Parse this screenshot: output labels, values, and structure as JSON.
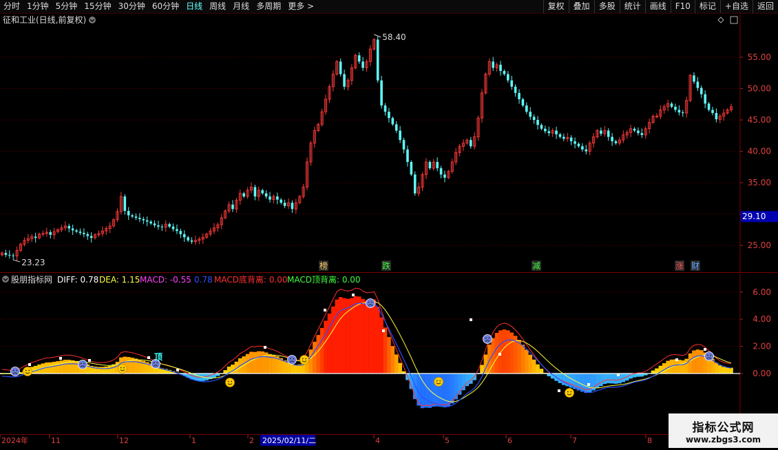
{
  "toolbar": {
    "periods": [
      "分时",
      "1分钟",
      "5分钟",
      "15分钟",
      "30分钟",
      "60分钟",
      "日线",
      "周线",
      "月线",
      "多周期",
      "更多 >"
    ],
    "active": "日线",
    "right": [
      "复权",
      "叠加",
      "多股",
      "统计",
      "画线",
      "F10",
      "标记",
      "+自选",
      "返回"
    ]
  },
  "main": {
    "title": "征和工业(日线,前复权)",
    "high_label": "58.40",
    "low_label": "23.23",
    "price_ticks": [
      "55.00",
      "50.00",
      "45.00",
      "40.00",
      "35.00",
      "25.00"
    ],
    "current_price": "29.10",
    "markers": [
      {
        "text": "榜",
        "color": "#ffcc66"
      },
      {
        "text": "跌",
        "color": "#3dff3d"
      },
      {
        "text": "减",
        "color": "#3dff3d"
      },
      {
        "text": "涨",
        "color": "#ff5555"
      },
      {
        "text": "财",
        "color": "#66aaff"
      }
    ]
  },
  "sub": {
    "indicator_name": "股朋指标网",
    "diff": "DIFF: 0.78",
    "dea": "DEA: 1.15",
    "macd": "MACD: -0.55",
    "extra": "0.78",
    "bottom_div": "MACD底背离: 0.00",
    "top_div": "MACD顶背离: 0.00",
    "annotation": "顶",
    "ticks": [
      "6.00",
      "4.00",
      "2.00",
      "0.00"
    ]
  },
  "timebar": {
    "labels": [
      "2024年",
      "11",
      "12",
      "1",
      "2",
      "2025/02/11/二",
      "4",
      "5",
      "6",
      "7",
      "8"
    ]
  },
  "watermark": {
    "line1": "指标公式网",
    "line2": "www.zbgs3.com"
  },
  "colors": {
    "up": "#ff3a3a",
    "down": "#5ff7f7",
    "diff": "#ff3030",
    "dea": "#ffff40",
    "macd_line": "#2a50ff"
  },
  "chart_data": {
    "type": "candlestick",
    "price_ylim": [
      21.5,
      59.5
    ],
    "close": [
      23.8,
      23.5,
      23.4,
      23.3,
      24.2,
      25.2,
      25.8,
      26.1,
      26.4,
      26.2,
      26.8,
      26.9,
      27.1,
      26.7,
      27.2,
      27.5,
      27.8,
      28.1,
      27.7,
      27.4,
      27.2,
      27.0,
      26.8,
      26.5,
      26.2,
      26.7,
      26.9,
      27.3,
      27.7,
      28.1,
      29.1,
      30.4,
      32.8,
      30.5,
      29.8,
      29.6,
      29.4,
      29.2,
      29.0,
      28.8,
      28.5,
      28.2,
      28.0,
      27.9,
      28.4,
      28.0,
      27.6,
      27.3,
      26.8,
      26.3,
      25.8,
      25.6,
      25.8,
      26.0,
      26.3,
      26.8,
      27.3,
      27.8,
      28.3,
      29.4,
      30.5,
      31.5,
      30.8,
      32.2,
      33.3,
      32.8,
      33.8,
      34.3,
      32.8,
      33.8,
      33.3,
      32.8,
      32.3,
      32.8,
      32.3,
      31.8,
      31.3,
      31.8,
      30.8,
      31.8,
      32.8,
      34.3,
      38.3,
      41.3,
      43.3,
      44.3,
      46.3,
      48.3,
      50.3,
      52.3,
      54.3,
      52.3,
      50.3,
      51.3,
      53.3,
      55.3,
      54.3,
      53.3,
      54.3,
      56.3,
      57.8,
      51.3,
      47.3,
      46.3,
      45.3,
      44.3,
      43.3,
      41.8,
      40.3,
      38.3,
      36.3,
      33.3,
      34.3,
      36.3,
      38.3,
      37.3,
      38.3,
      37.3,
      36.3,
      35.8,
      36.8,
      38.3,
      39.8,
      40.8,
      41.3,
      41.8,
      40.8,
      42.3,
      45.3,
      49.3,
      52.3,
      54.3,
      53.3,
      53.8,
      52.8,
      52.3,
      51.3,
      50.3,
      49.3,
      48.3,
      47.3,
      46.3,
      45.5,
      45.0,
      44.2,
      43.6,
      43.2,
      42.9,
      43.3,
      42.7,
      42.3,
      42.0,
      42.2,
      41.6,
      41.2,
      40.8,
      40.3,
      40.0,
      41.3,
      42.3,
      43.3,
      42.8,
      43.3,
      42.3,
      41.6,
      41.3,
      41.8,
      42.6,
      43.0,
      43.6,
      43.3,
      42.9,
      42.6,
      43.6,
      44.6,
      45.6,
      45.6,
      46.6,
      47.1,
      47.6,
      47.1,
      46.6,
      46.2,
      46.1,
      48.1,
      52.1,
      51.1,
      50.1,
      49.1,
      47.6,
      46.6,
      46.1,
      45.1,
      45.6,
      46.1,
      46.6,
      47.1
    ]
  }
}
